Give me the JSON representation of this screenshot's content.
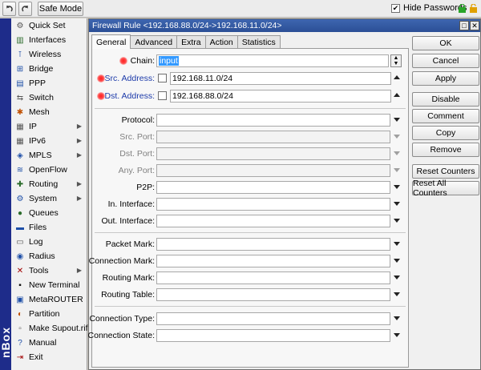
{
  "toolbar": {
    "undo_icon": "undo-icon",
    "redo_icon": "redo-icon",
    "safe_mode_label": "Safe Mode",
    "hide_passwords_label": "Hide Passwords",
    "hide_passwords_checked": true,
    "lock_colors": [
      "#2aa52a",
      "#e0a000"
    ]
  },
  "brand": {
    "text": "nBox",
    "color": "#1e2c8a"
  },
  "sidebar": {
    "items": [
      {
        "label": "Quick Set",
        "icon": "quick-set-icon",
        "submenu": false
      },
      {
        "label": "Interfaces",
        "icon": "interfaces-icon",
        "submenu": false
      },
      {
        "label": "Wireless",
        "icon": "wireless-icon",
        "submenu": false
      },
      {
        "label": "Bridge",
        "icon": "bridge-icon",
        "submenu": false
      },
      {
        "label": "PPP",
        "icon": "ppp-icon",
        "submenu": false
      },
      {
        "label": "Switch",
        "icon": "switch-icon",
        "submenu": false
      },
      {
        "label": "Mesh",
        "icon": "mesh-icon",
        "submenu": false
      },
      {
        "label": "IP",
        "icon": "ip-icon",
        "submenu": true
      },
      {
        "label": "IPv6",
        "icon": "ipv6-icon",
        "submenu": true
      },
      {
        "label": "MPLS",
        "icon": "mpls-icon",
        "submenu": true
      },
      {
        "label": "OpenFlow",
        "icon": "openflow-icon",
        "submenu": false
      },
      {
        "label": "Routing",
        "icon": "routing-icon",
        "submenu": true
      },
      {
        "label": "System",
        "icon": "system-icon",
        "submenu": true
      },
      {
        "label": "Queues",
        "icon": "queues-icon",
        "submenu": false
      },
      {
        "label": "Files",
        "icon": "files-icon",
        "submenu": false
      },
      {
        "label": "Log",
        "icon": "log-icon",
        "submenu": false
      },
      {
        "label": "Radius",
        "icon": "radius-icon",
        "submenu": false
      },
      {
        "label": "Tools",
        "icon": "tools-icon",
        "submenu": true
      },
      {
        "label": "New Terminal",
        "icon": "terminal-icon",
        "submenu": false
      },
      {
        "label": "MetaROUTER",
        "icon": "metarouter-icon",
        "submenu": false
      },
      {
        "label": "Partition",
        "icon": "partition-icon",
        "submenu": false
      },
      {
        "label": "Make Supout.rif",
        "icon": "supout-icon",
        "submenu": false
      },
      {
        "label": "Manual",
        "icon": "manual-icon",
        "submenu": false
      },
      {
        "label": "Exit",
        "icon": "exit-icon",
        "submenu": false
      }
    ]
  },
  "dialog": {
    "title": "Firewall Rule <192.168.88.0/24->192.168.11.0/24>",
    "tabs": [
      "General",
      "Advanced",
      "Extra",
      "Action",
      "Statistics"
    ],
    "active_tab": "General",
    "fields": {
      "chain": {
        "label": "Chain:",
        "value": "input"
      },
      "src_address": {
        "label": "Src. Address:",
        "value": "192.168.11.0/24"
      },
      "dst_address": {
        "label": "Dst. Address:",
        "value": "192.168.88.0/24"
      },
      "protocol": {
        "label": "Protocol:",
        "value": ""
      },
      "src_port": {
        "label": "Src. Port:",
        "value": ""
      },
      "dst_port": {
        "label": "Dst. Port:",
        "value": ""
      },
      "any_port": {
        "label": "Any. Port:",
        "value": ""
      },
      "p2p": {
        "label": "P2P:",
        "value": ""
      },
      "in_interface": {
        "label": "In. Interface:",
        "value": ""
      },
      "out_interface": {
        "label": "Out. Interface:",
        "value": ""
      },
      "packet_mark": {
        "label": "Packet Mark:",
        "value": ""
      },
      "connection_mark": {
        "label": "Connection Mark:",
        "value": ""
      },
      "routing_mark": {
        "label": "Routing Mark:",
        "value": ""
      },
      "routing_table": {
        "label": "Routing Table:",
        "value": ""
      },
      "connection_type": {
        "label": "Connection Type:",
        "value": ""
      },
      "connection_state": {
        "label": "Connection State:",
        "value": ""
      }
    },
    "buttons": {
      "ok": "OK",
      "cancel": "Cancel",
      "apply": "Apply",
      "disable": "Disable",
      "comment": "Comment",
      "copy": "Copy",
      "remove": "Remove",
      "reset_counters": "Reset Counters",
      "reset_all_counters": "Reset All Counters"
    },
    "colors": {
      "title_bar": "#2b4f96",
      "required_marker": "#ff2020",
      "blue_label": "#1c3aa9"
    }
  }
}
